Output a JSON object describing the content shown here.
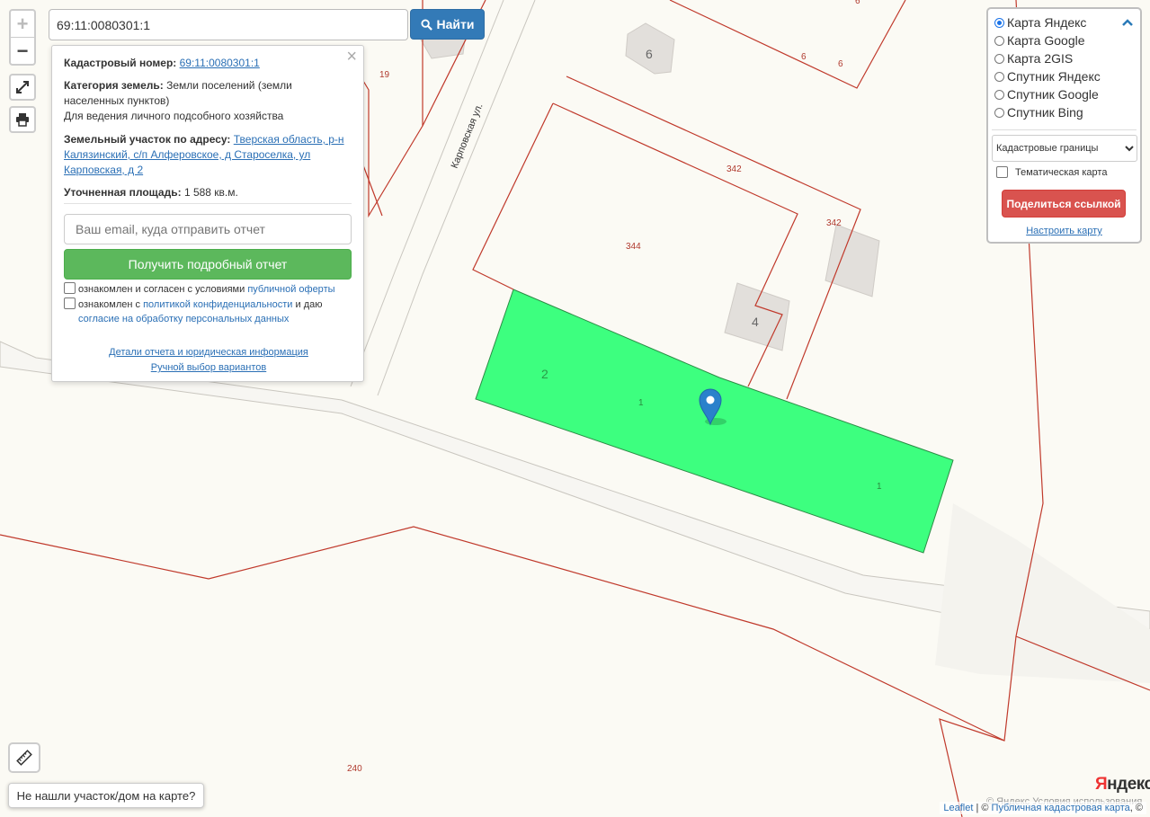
{
  "search": {
    "value": "69:11:0080301:1",
    "button_label": "Найти"
  },
  "popup": {
    "cadastral_label": "Кадастровый номер:",
    "cadastral_value": "69:11:0080301:1",
    "category_label": "Категория земель:",
    "category_value": "Земли поселений (земли населенных пунктов)",
    "usage": "Для ведения личного подсобного хозяйства",
    "address_label": "Земельный участок по адресу:",
    "address_value": "Тверская область, р-н Калязинский, с/п Алферовское, д Староселка, ул Карповская, д 2",
    "area_label": "Уточненная площадь:",
    "area_value": "1 588 кв.м.",
    "email_placeholder": "Ваш email, куда отправить отчет",
    "get_report_label": "Получить подробный отчет",
    "agree1_prefix": "ознакомлен и согласен с условиями",
    "agree1_link": "публичной оферты",
    "agree2_prefix": "ознакомлен с",
    "agree2_link": "политикой конфиденциальности",
    "agree2_mid": "и даю",
    "agree2_link2": "согласие на обработку персональных данных",
    "details_link": "Детали отчета и юридическая информация",
    "manual_link": "Ручной выбор вариантов"
  },
  "layers": {
    "options": [
      {
        "label": "Карта Яндекс",
        "selected": true
      },
      {
        "label": "Карта Google",
        "selected": false
      },
      {
        "label": "Карта 2GIS",
        "selected": false
      },
      {
        "label": "Спутник Яндекс",
        "selected": false
      },
      {
        "label": "Спутник Google",
        "selected": false
      },
      {
        "label": "Спутник Bing",
        "selected": false
      }
    ],
    "overlay_select": "Кадастровые границы",
    "thematic_label": "Тематическая карта",
    "share_label": "Поделиться ссылкой",
    "configure_label": "Настроить карту"
  },
  "map": {
    "street_label": "Карповская ул.",
    "parcel_labels": [
      "19",
      "6",
      "6",
      "6",
      "342",
      "342",
      "344",
      "1",
      "1",
      "240"
    ],
    "house_numbers": [
      "6",
      "4",
      "2"
    ],
    "highlight_color": "#3dff7f",
    "border_color": "#c0392b"
  },
  "not_found_label": "Не нашли участок/дом на карте?",
  "attribution": {
    "leaflet": "Leaflet",
    "separator": "| ©",
    "pkk": "Публичная кадастровая карта",
    "tail": ", ©"
  },
  "yandex": {
    "ya": "Я",
    "ndex": "ндекс",
    "license": "© Яндекс Условия использования"
  },
  "icons": {
    "zoom_in": "+",
    "zoom_out": "−",
    "close": "×"
  }
}
